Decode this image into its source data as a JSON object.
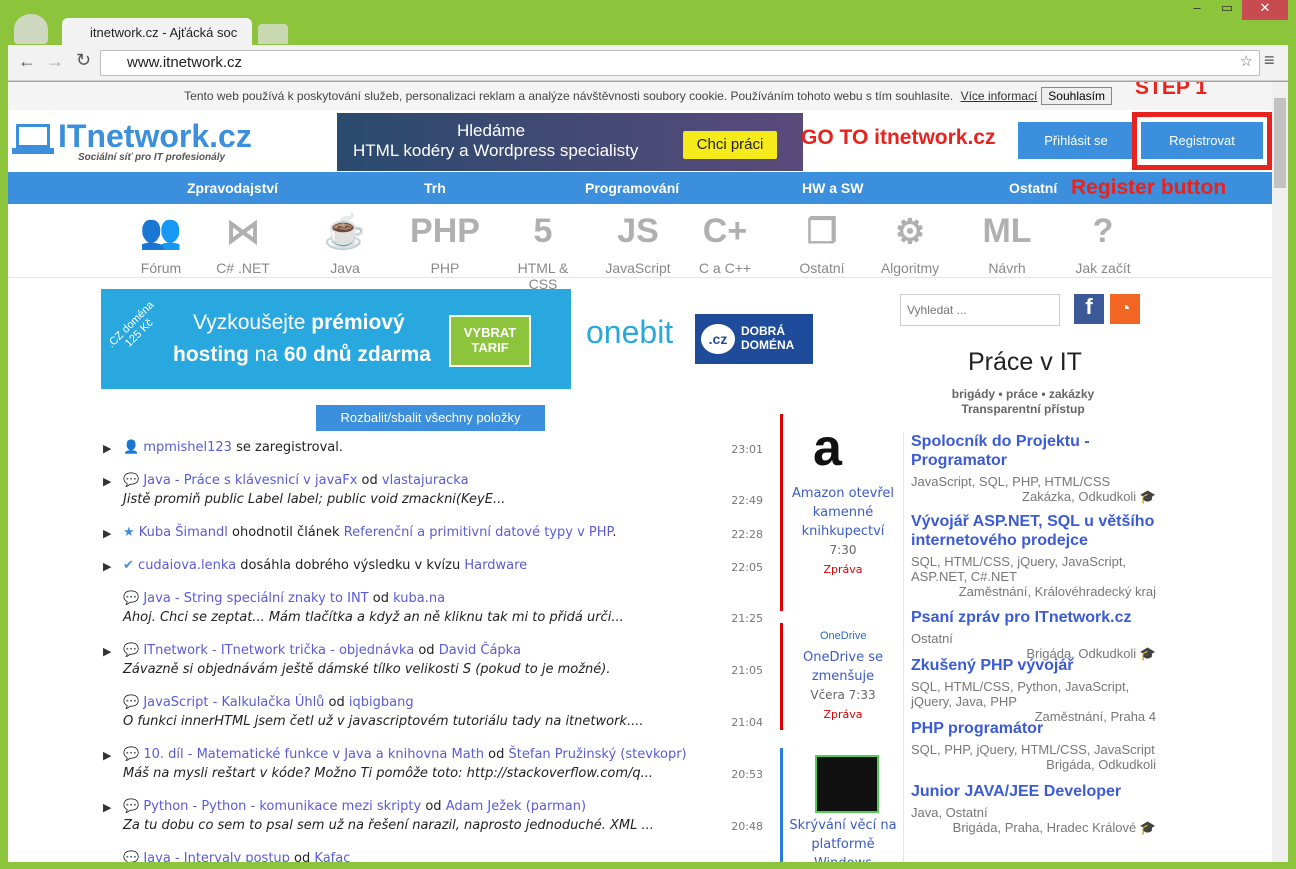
{
  "browser": {
    "tab_title": "itnetwork.cz - Ajťácká soc",
    "url": "www.itnetwork.cz"
  },
  "cookie": {
    "text": "Tento web používá k poskytování služeb, personalizaci reklam a analýze návštěvnosti soubory cookie. Používáním tohoto webu s tím souhlasíte.",
    "more": "Více informací",
    "agree": "Souhlasím"
  },
  "logo": {
    "title": "ITnetwork.cz",
    "subtitle": "Sociální síť pro IT profesionály"
  },
  "banner": {
    "line1": "Hledáme",
    "line2": "HTML kodéry a Wordpress specialisty",
    "button": "Chci práci"
  },
  "auth": {
    "login": "Přihlásit se",
    "register": "Registrovat"
  },
  "annotations": {
    "step": "STEP 1",
    "goto": "GO TO itnetwork.cz",
    "register": "Register button"
  },
  "nav": [
    "Zpravodajství",
    "Trh",
    "Programování",
    "HW a SW",
    "Ostatní"
  ],
  "categories": [
    {
      "label": "Fórum",
      "glyph": "👥"
    },
    {
      "label": "C# .NET",
      "glyph": "⋈"
    },
    {
      "label": "Java",
      "glyph": "☕"
    },
    {
      "label": "PHP",
      "glyph": "PHP"
    },
    {
      "label": "HTML & CSS",
      "glyph": "5"
    },
    {
      "label": "JavaScript",
      "glyph": "JS"
    },
    {
      "label": "C a C++",
      "glyph": "C+"
    },
    {
      "label": "Ostatní",
      "glyph": "❐"
    },
    {
      "label": "Algoritmy",
      "glyph": "⚙"
    },
    {
      "label": "Návrh",
      "glyph": "ML"
    },
    {
      "label": "Jak začít",
      "glyph": "?"
    }
  ],
  "ad": {
    "badge": ".CZ doména 125 Kč",
    "text1": "Vyzkoušejte ",
    "bold1": "prémiový",
    "text2": "hosting",
    "text3": " na ",
    "bold2": "60 dnů zdarma",
    "button": "VYBRAT TARIF",
    "onebit": "onebit",
    "domena": "DOBRÁ DOMÉNA",
    "cz": ".cz"
  },
  "search": {
    "placeholder": "Vyhledat ..."
  },
  "toggle_all": "Rozbalit/sbalit všechny položky",
  "feed": [
    {
      "icon": "user-icon",
      "a": "mpmishel123",
      "b": " se zaregistroval.",
      "c": "",
      "d": "",
      "time": "23:01",
      "sub": ""
    },
    {
      "icon": "comment-icon",
      "a": "Java - Práce s klávesnicí v javaFx",
      "b": " od ",
      "c": "vlastajuracka",
      "d": "",
      "time": "22:49",
      "sub": "Jistě promiň public Label label; public void zmackni(KeyE..."
    },
    {
      "icon": "star-icon",
      "a": "Kuba Šimandl",
      "b": " ohodnotil článek ",
      "c": "Referenční a primitivní datové typy v PHP",
      "d": ".",
      "time": "22:28",
      "sub": ""
    },
    {
      "icon": "check-icon",
      "a": "cudaiova.lenka",
      "b": " dosáhla dobrého výsledku v kvízu ",
      "c": "Hardware",
      "d": "",
      "time": "22:05",
      "sub": ""
    },
    {
      "icon": "comment-icon",
      "a": "Java - String speciální znaky to INT",
      "b": " od ",
      "c": "kuba.na",
      "d": "",
      "time": "21:25",
      "sub": "Ahoj. Chci se zeptat... Mám tlačítka a když an ně kliknu tak mi to přidá urči..."
    },
    {
      "icon": "comment-icon",
      "a": "ITnetwork - ITnetwork trička - objednávka",
      "b": " od ",
      "c": "David Čápka",
      "d": "",
      "time": "21:05",
      "sub": "Závazně si objednávám ještě dámské tílko velikosti S (pokud to je možné)."
    },
    {
      "icon": "comment-icon",
      "a": "JavaScript - Kalkulačka Úhlů",
      "b": " od ",
      "c": "iqbigbang",
      "d": "",
      "time": "21:04",
      "sub": "O funkci innerHTML jsem četl už v javascriptovém tutoriálu tady na itnetwork...."
    },
    {
      "icon": "comment-icon",
      "a": "10. díl - Matematické funkce v Java a knihovna Math",
      "b": " od ",
      "c": "Štefan Pružinský (stevkopr)",
      "d": "",
      "time": "20:53",
      "sub": "Máš na mysli reštart v kóde? Možno Ti pomôže toto: http://stackoverflow.com/q..."
    },
    {
      "icon": "comment-icon",
      "a": "Python - Python - komunikace mezi skripty",
      "b": " od ",
      "c": "Adam Ježek (parman)",
      "d": "",
      "time": "20:48",
      "sub": "Za tu dobu co sem to psal sem už na řešení narazil, naprosto jednoduché. XML ..."
    },
    {
      "icon": "comment-icon",
      "a": "Java - Intervaly postup",
      "b": " od ",
      "c": "Kafac",
      "d": "",
      "time": "",
      "sub": ""
    }
  ],
  "news": [
    {
      "title": "Amazon otevřel kamenné knihkupectví",
      "time": "7:30",
      "tag": "Zpráva"
    },
    {
      "title": "OneDrive se zmenšuje",
      "time": "Včera 7:33",
      "tag": "Zpráva",
      "logo": "OneDrive"
    },
    {
      "title": "Skrývání věcí na platformě Windows",
      "time": "",
      "tag": ""
    }
  ],
  "jobs_header": {
    "title": "Práce v IT",
    "sub1": "brigády • práce • zakázky",
    "sub2": "Transparentní přístup"
  },
  "jobs": [
    {
      "title": "Spolocník do Projektu - Programator",
      "skills": "JavaScript, SQL, PHP, HTML/CSS",
      "meta": "Zakázka, Odkudkoli 🎓"
    },
    {
      "title": "Vývojář ASP.NET, SQL u většího internetového prodejce",
      "skills": "SQL, HTML/CSS, jQuery, JavaScript, ASP.NET, C#.NET",
      "meta": "Zaměstnání, Královéhradecký kraj"
    },
    {
      "title": "Psaní zpráv pro ITnetwork.cz",
      "skills": "Ostatní",
      "meta": "Brigáda, Odkudkoli 🎓"
    },
    {
      "title": "Zkušený PHP vývojář",
      "skills": "SQL, HTML/CSS, Python, JavaScript, jQuery, Java, PHP",
      "meta": "Zaměstnání, Praha 4"
    },
    {
      "title": "PHP programátor",
      "skills": "SQL, PHP, jQuery, HTML/CSS, JavaScript",
      "meta": "Brigáda, Odkudkoli"
    },
    {
      "title": "Junior JAVA/JEE Developer",
      "skills": "Java, Ostatní",
      "meta": "Brigáda, Praha, Hradec Králové 🎓"
    }
  ],
  "colors": {
    "frame": "#8cc43c",
    "brand": "#3b8fdc",
    "annotation": "#e8231e"
  }
}
